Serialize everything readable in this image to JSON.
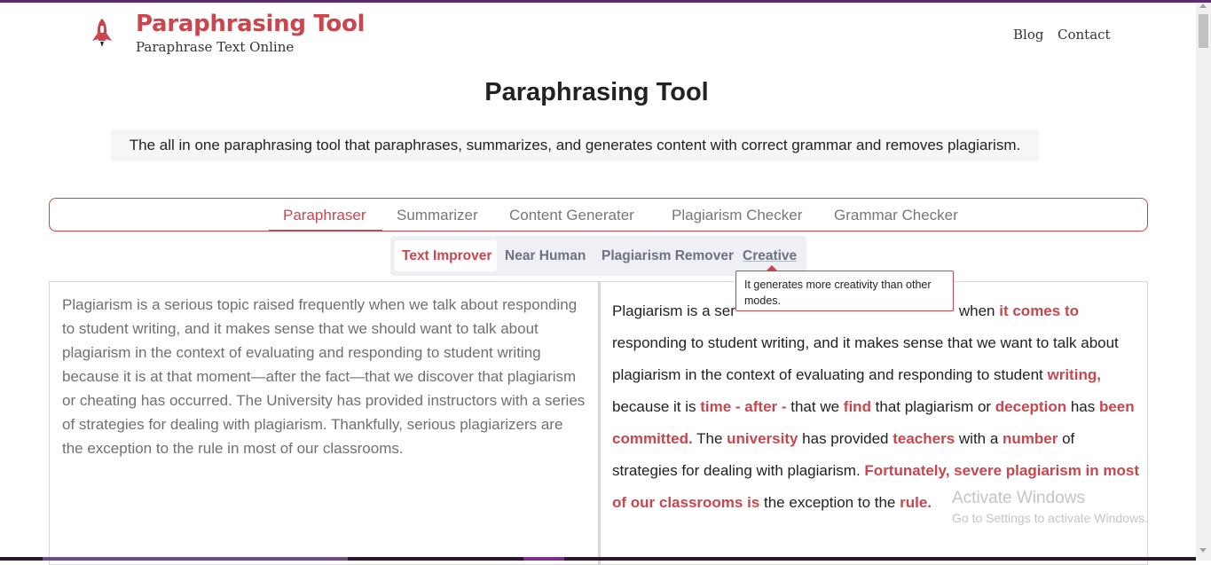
{
  "header": {
    "brand_title": "Paraphrasing Tool",
    "brand_subtitle": "Paraphrase Text Online",
    "nav": {
      "blog": "Blog",
      "contact": "Contact"
    }
  },
  "main": {
    "title": "Paraphrasing Tool",
    "subtitle": "The all in one paraphrasing tool that paraphrases, summarizes, and generates content with correct grammar and removes plagiarism.",
    "tabs": [
      {
        "label": "Paraphraser",
        "active": true
      },
      {
        "label": "Summarizer",
        "active": false
      },
      {
        "label": "Content Generater",
        "active": false
      },
      {
        "label": "Plagiarism Checker",
        "active": false
      },
      {
        "label": "Grammar Checker",
        "active": false
      }
    ],
    "modes": [
      {
        "label": "Text Improver",
        "active": true
      },
      {
        "label": "Near Human",
        "active": false
      },
      {
        "label": "Plagiarism Remover",
        "active": false
      },
      {
        "label": "Creative",
        "active": false
      }
    ],
    "tooltip": "It generates more creativity than other modes.",
    "input_text": "Plagiarism is a serious topic raised frequently when we talk about responding to student writing, and it makes sense that we should want to talk about plagiarism in the context of evaluating and responding to student writing because it is at that moment—after the fact—that we discover that plagiarism or cheating has occurred. The University has provided instructors with a series of strategies for dealing with plagiarism. Thankfully, serious plagiarizers are the exception to the rule in most of our classrooms.",
    "output_segments": [
      {
        "text": "Plagiarism is a ser",
        "highlight": false
      },
      {
        "text": "when ",
        "highlight": false
      },
      {
        "text": "it comes to",
        "highlight": true
      },
      {
        "text": " responding to student writing, and it makes sense that we want to talk about plagiarism in the context of evaluating and responding to student ",
        "highlight": false
      },
      {
        "text": "writing,",
        "highlight": true
      },
      {
        "text": " because it is ",
        "highlight": false
      },
      {
        "text": "time - after -",
        "highlight": true
      },
      {
        "text": " that we ",
        "highlight": false
      },
      {
        "text": "find",
        "highlight": true
      },
      {
        "text": " that plagiarism or ",
        "highlight": false
      },
      {
        "text": "deception",
        "highlight": true
      },
      {
        "text": " has ",
        "highlight": false
      },
      {
        "text": "been committed.",
        "highlight": true
      },
      {
        "text": " The ",
        "highlight": false
      },
      {
        "text": "university",
        "highlight": true
      },
      {
        "text": " has provided ",
        "highlight": false
      },
      {
        "text": "teachers",
        "highlight": true
      },
      {
        "text": " with a ",
        "highlight": false
      },
      {
        "text": "number",
        "highlight": true
      },
      {
        "text": " of strategies for dealing with plagiarism. ",
        "highlight": false
      },
      {
        "text": "Fortunately, severe plagiarism in most of our classrooms is",
        "highlight": true
      },
      {
        "text": " the exception to the ",
        "highlight": false
      },
      {
        "text": "rule.",
        "highlight": true
      }
    ]
  },
  "overlay": {
    "watermark_title": "Activate Windows",
    "watermark_sub": "Go to Settings to activate Windows."
  },
  "colors": {
    "accent": "#c9464f",
    "mode_bar_bg": "#eef0f4",
    "muted_text": "#707070"
  },
  "icons": {
    "logo": "rocket-icon"
  }
}
